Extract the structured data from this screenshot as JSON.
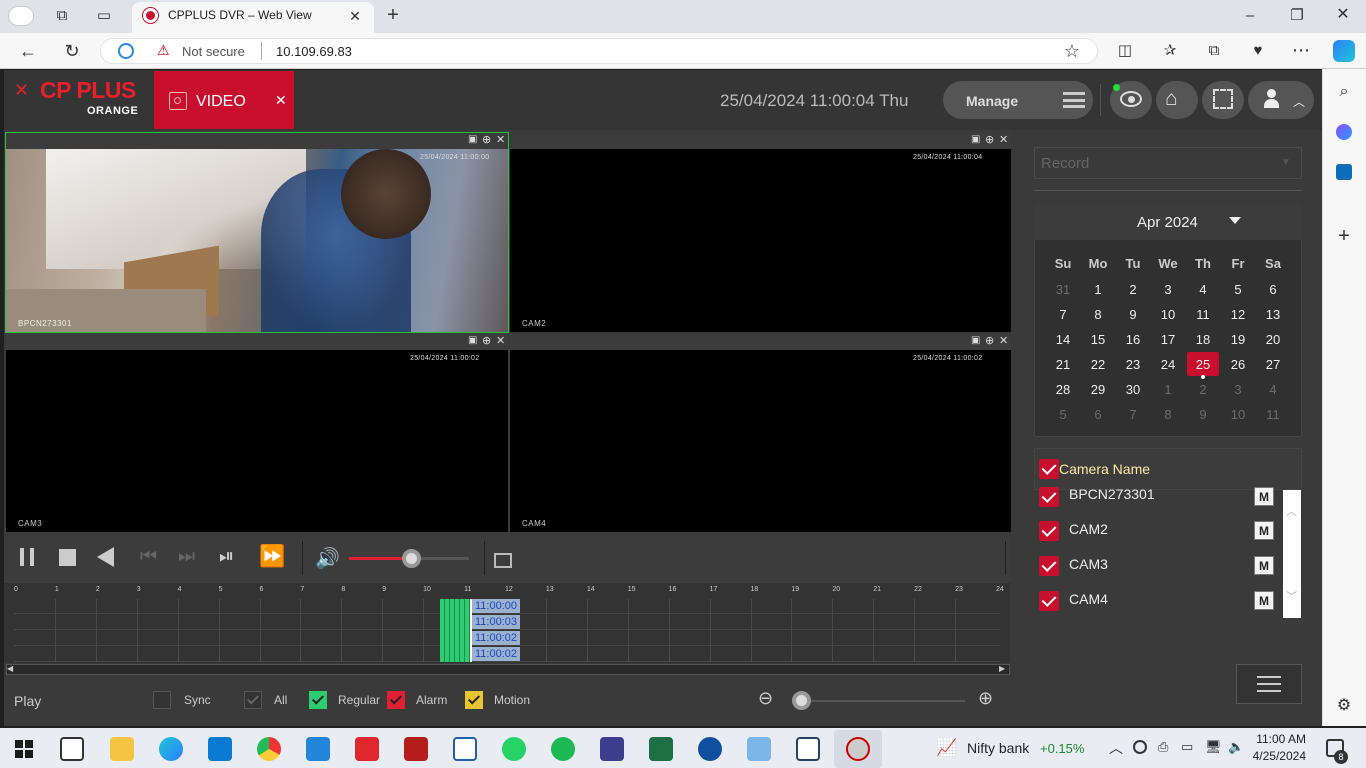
{
  "browser": {
    "tab_title": "CPPLUS DVR – Web View",
    "security_label": "Not secure",
    "url": "10.109.69.83"
  },
  "header": {
    "logo_text": "CP PLUS",
    "logo_sub": "ORANGE",
    "video_tab": "VIDEO",
    "datetime": "25/04/2024 11:00:04 Thu",
    "manage_label": "Manage"
  },
  "cameras": [
    {
      "title": "BPCN273301",
      "timestamp": "25/04/2024 11:00:00"
    },
    {
      "title": "CAM2",
      "timestamp": "25/04/2024 11:00:04"
    },
    {
      "title": "CAM3",
      "timestamp": "25/04/2024 11:00:02"
    },
    {
      "title": "CAM4",
      "timestamp": "25/04/2024 11:00:02"
    }
  ],
  "timeline": {
    "hours": [
      "0",
      "1",
      "2",
      "3",
      "4",
      "5",
      "6",
      "7",
      "8",
      "9",
      "10",
      "11",
      "12",
      "13",
      "14",
      "15",
      "16",
      "17",
      "18",
      "19",
      "20",
      "21",
      "22",
      "23",
      "24"
    ],
    "row_times": [
      "11:00:00",
      "11:00:03",
      "11:00:02",
      "11:00:02"
    ]
  },
  "record_select": {
    "placeholder": "Record"
  },
  "calendar": {
    "month_label": "Apr 2024",
    "weekdays": [
      "Su",
      "Mo",
      "Tu",
      "We",
      "Th",
      "Fr",
      "Sa"
    ],
    "weeks": [
      [
        "31",
        "1",
        "2",
        "3",
        "4",
        "5",
        "6"
      ],
      [
        "7",
        "8",
        "9",
        "10",
        "11",
        "12",
        "13"
      ],
      [
        "14",
        "15",
        "16",
        "17",
        "18",
        "19",
        "20"
      ],
      [
        "21",
        "22",
        "23",
        "24",
        "25",
        "26",
        "27"
      ],
      [
        "28",
        "29",
        "30",
        "1",
        "2",
        "3",
        "4"
      ],
      [
        "5",
        "6",
        "7",
        "8",
        "9",
        "10",
        "11"
      ]
    ],
    "selected": "25"
  },
  "camera_list": {
    "header": "Camera Name",
    "items": [
      "BPCN273301",
      "CAM2",
      "CAM3",
      "CAM4"
    ],
    "m_label": "M"
  },
  "playbar": {
    "mode": "Play",
    "sync": "Sync",
    "all": "All",
    "regular": "Regular",
    "alarm": "Alarm",
    "motion": "Motion"
  },
  "taskbar": {
    "stock_name": "Nifty bank",
    "stock_change": "+0.15%",
    "time": "11:00 AM",
    "date": "4/25/2024",
    "notif_count": "8"
  },
  "colors": {
    "accent_red": "#c8102e",
    "regular_green": "#2ecc71",
    "motion_yellow": "#e8c530"
  }
}
